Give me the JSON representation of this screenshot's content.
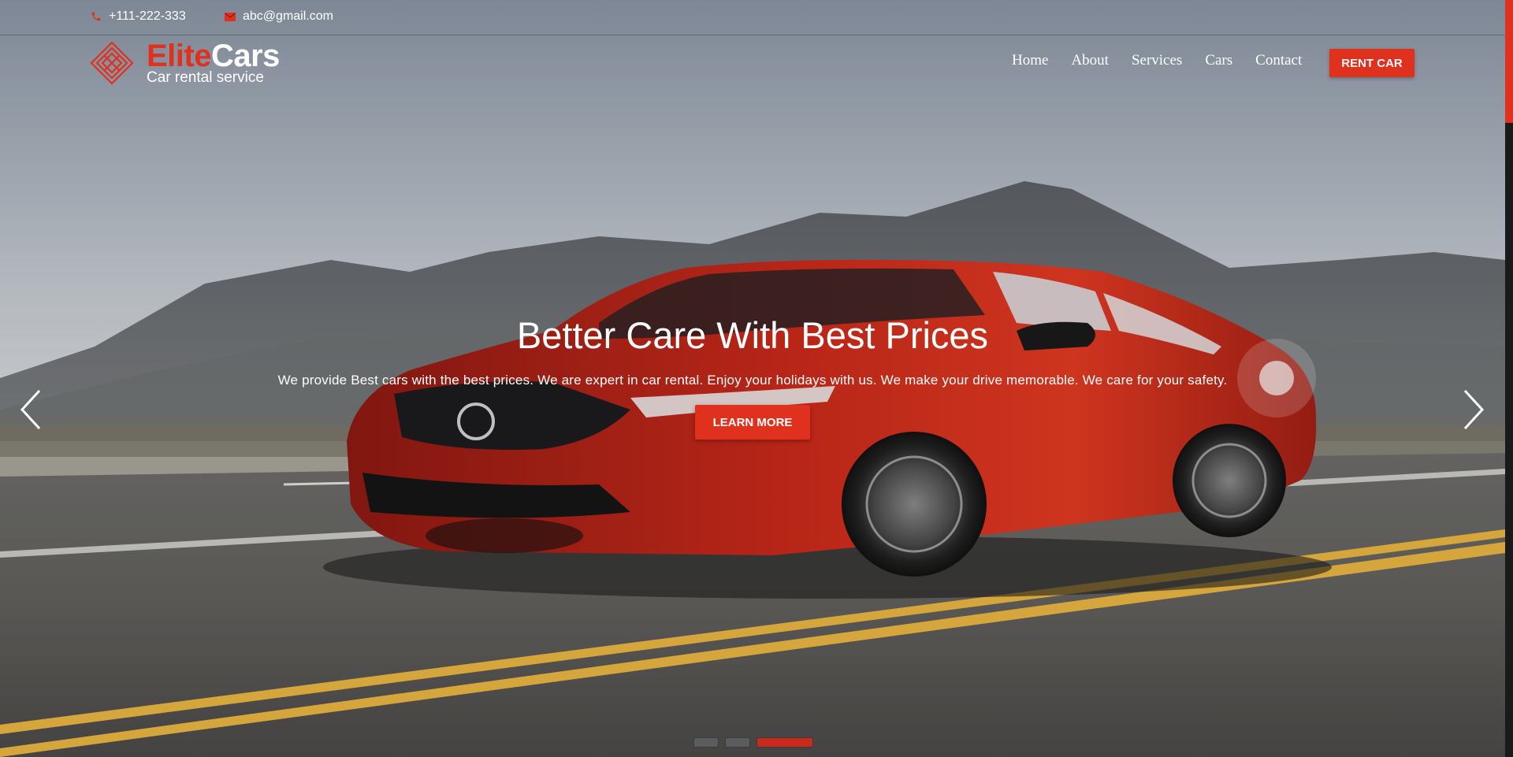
{
  "topbar": {
    "phone": "+111-222-333",
    "email": "abc@gmail.com",
    "phone_icon": "phone-icon",
    "email_icon": "envelope-icon"
  },
  "logo": {
    "brand_part1": "Elite",
    "brand_part2": "Cars",
    "tagline": "Car rental service",
    "icon": "diamond-grid-logo-icon"
  },
  "nav": {
    "items": [
      {
        "label": "Home"
      },
      {
        "label": "About"
      },
      {
        "label": "Services"
      },
      {
        "label": "Cars"
      },
      {
        "label": "Contact"
      }
    ],
    "cta_label": "RENT CAR"
  },
  "slider": {
    "title": "Better Care With Best Prices",
    "description": "We provide Best cars with the best prices. We are expert in car rental. Enjoy your holidays with us. We make your drive memorable. We care for your safety.",
    "button_label": "LEARN MORE",
    "prev_icon": "chevron-left-icon",
    "next_icon": "chevron-right-icon",
    "slide_count": 3,
    "active_slide": 3
  },
  "colors": {
    "accent": "#e0301e",
    "text_light": "#ffffff"
  }
}
